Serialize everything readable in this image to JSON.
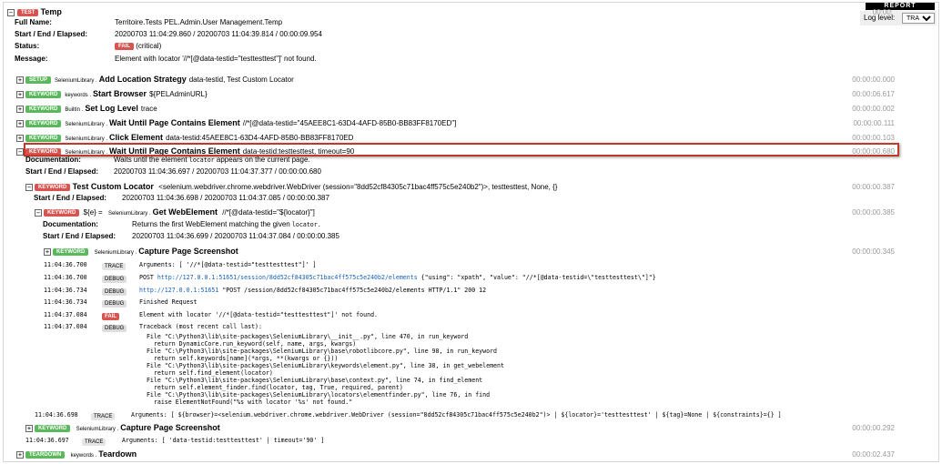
{
  "header": {
    "report_tab": "REPORT",
    "log_level_label": "Log level:",
    "log_level_value": "TRACE"
  },
  "test": {
    "badge": "TEST",
    "name": "Temp",
    "elapsed": "00:00:",
    "full_name_label": "Full Name:",
    "full_name": "Territoire.Tests PEL.Admin.User Management.Temp",
    "times_label": "Start / End / Elapsed:",
    "times": "20200703 11:04:29.860 / 20200703 11:04:39.814 / 00:00:09.954",
    "status_label": "Status:",
    "status_badge": "FAIL",
    "status_note": "(critical)",
    "message_label": "Message:",
    "message": "Element with locator '//*[@data-testid=\"testtesttest\"]' not found."
  },
  "keywords": [
    {
      "badge": "SETUP",
      "lib": "SeleniumLibrary .",
      "name": "Add Location Strategy",
      "args": "data-testid, Test Custom Locator",
      "elapsed": "00:00:00.000",
      "color": "green"
    },
    {
      "badge": "KEYWORD",
      "lib": "keywords .",
      "name": "Start Browser",
      "args": "${PELAdminURL}",
      "elapsed": "00:00:06.617",
      "color": "green"
    },
    {
      "badge": "KEYWORD",
      "lib": "BuiltIn .",
      "name": "Set Log Level",
      "args": "trace",
      "elapsed": "00:00:00.002",
      "color": "green"
    },
    {
      "badge": "KEYWORD",
      "lib": "SeleniumLibrary .",
      "name": "Wait Until Page Contains Element",
      "args": "//*[@data-testid=\"45AEE8C1-63D4-4AFD-85B0-BB83FF8170ED\"]",
      "elapsed": "00:00:00.111",
      "color": "green"
    },
    {
      "badge": "KEYWORD",
      "lib": "SeleniumLibrary .",
      "name": "Click Element",
      "args": "data-testid:45AEE8C1-63D4-4AFD-85B0-BB83FF8170ED",
      "elapsed": "00:00:00.103",
      "color": "green"
    },
    {
      "badge": "KEYWORD",
      "lib": "SeleniumLibrary .",
      "name": "Wait Until Page Contains Element",
      "args": "data-testid:testtesttest, timeout=90",
      "elapsed": "00:00:00.680",
      "color": "red"
    }
  ],
  "wait_kw": {
    "doc_label": "Documentation:",
    "doc_pre": "Waits until the element ",
    "doc_code": "locator",
    "doc_post": " appears on the current page.",
    "times_label": "Start / End / Elapsed:",
    "times": "20200703 11:04:36.697 / 20200703 11:04:37.377 / 00:00:00.680"
  },
  "custom_kw": {
    "badge": "KEYWORD",
    "name": "Test Custom Locator",
    "args": "<selenium.webdriver.chrome.webdriver.WebDriver (session=\"8dd52cf84305c71bac4ff575c5e240b2\")>, testtesttest, None, {}",
    "elapsed": "00:00:00.387",
    "times_label": "Start / End / Elapsed:",
    "times": "20200703 11:04:36.698 / 20200703 11:04:37.085 / 00:00:00.387"
  },
  "get_kw": {
    "badge": "KEYWORD",
    "assign": "${e} =",
    "lib": "SeleniumLibrary .",
    "name": "Get WebElement",
    "args": "//*[@data-testid=\"${locator}\"]",
    "elapsed": "00:00:00.385",
    "doc_label": "Documentation:",
    "doc_pre": "Returns the first WebElement matching the given ",
    "doc_code": "locator.",
    "times_label": "Start / End / Elapsed:",
    "times": "20200703 11:04:36.699 / 20200703 11:04:37.084 / 00:00:00.385"
  },
  "capture1": {
    "badge": "KEYWORD",
    "lib": "SeleniumLibrary .",
    "name": "Capture Page Screenshot",
    "elapsed": "00:00:00.345"
  },
  "logs": [
    {
      "ts": "11:04:36.700",
      "level": "TRACE",
      "msg": "Arguments: [ '//*[@data-testid=\"testtesttest\"]' ]"
    },
    {
      "ts": "11:04:36.700",
      "level": "DEBUG",
      "msg_pre": "POST ",
      "link": "http://127.0.0.1:51651/session/8dd52cf84305c71bac4ff575c5e240b2/elements",
      "msg_post": " {\"using\": \"xpath\", \"value\": \"//*[@data-testid=\\\"testtesttest\\\"]\"}"
    },
    {
      "ts": "11:04:36.734",
      "level": "DEBUG",
      "msg_pre": "",
      "link": "http://127.0.0.1:51651",
      "msg_post": " \"POST /session/8dd52cf84305c71bac4ff575c5e240b2/elements HTTP/1.1\" 200 12"
    },
    {
      "ts": "11:04:36.734",
      "level": "DEBUG",
      "msg": "Finished Request"
    },
    {
      "ts": "11:04:37.084",
      "level": "FAIL",
      "msg": "Element with locator '//*[@data-testid=\"testtesttest\"]' not found."
    },
    {
      "ts": "11:04:37.084",
      "level": "DEBUG",
      "msg": "Traceback (most recent call last):"
    }
  ],
  "traceback": [
    "  File \"C:\\Python3\\lib\\site-packages\\SeleniumLibrary\\__init__.py\", line 470, in run_keyword",
    "    return DynamicCore.run_keyword(self, name, args, kwargs)",
    "  File \"C:\\Python3\\lib\\site-packages\\SeleniumLibrary\\base\\robotlibcore.py\", line 98, in run_keyword",
    "    return self.keywords[name](*args, **(kwargs or {}))",
    "  File \"C:\\Python3\\lib\\site-packages\\SeleniumLibrary\\keywords\\element.py\", line 38, in get_webelement",
    "    return self.find_element(locator)",
    "  File \"C:\\Python3\\lib\\site-packages\\SeleniumLibrary\\base\\context.py\", line 74, in find_element",
    "    return self.element_finder.find(locator, tag, True, required, parent)",
    "  File \"C:\\Python3\\lib\\site-packages\\SeleniumLibrary\\locators\\elementfinder.py\", line 76, in find",
    "    raise ElementNotFound(\"%s with locator '%s' not found.\""
  ],
  "custom_trace": {
    "ts": "11:04:36.698",
    "level": "TRACE",
    "msg": "Arguments: [ ${browser}=<selenium.webdriver.chrome.webdriver.WebDriver (session=\"8dd52cf84305c71bac4ff575c5e240b2\")> | ${locator}='testtesttest' | ${tag}=None | ${constraints}={} ]"
  },
  "capture2": {
    "badge": "KEYWORD",
    "lib": "SeleniumLibrary .",
    "name": "Capture Page Screenshot",
    "elapsed": "00:00:00.292"
  },
  "wait_trace": {
    "ts": "11:04:36.697",
    "level": "TRACE",
    "msg": "Arguments: [ 'data-testid:testtesttest' | timeout='90' ]"
  },
  "teardown": {
    "badge": "TEARDOWN",
    "lib": "keywords .",
    "name": "Teardown",
    "elapsed": "00:00:02.437"
  },
  "colors": {
    "fail": "#d9534f",
    "pass": "#5cb85c",
    "link": "#1560bd",
    "highlight": "#c0392b"
  }
}
